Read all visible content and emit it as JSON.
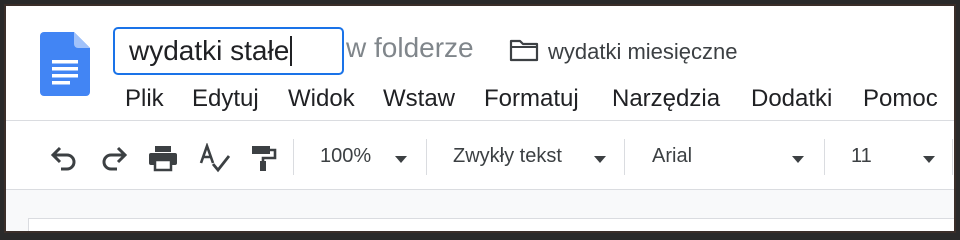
{
  "document": {
    "title": "wydatki stałe",
    "folder_hint": "w folderze",
    "folder_icon": "folder-icon",
    "folder_name": "wydatki miesięczne",
    "app_icon": "google-docs-icon",
    "accent_color": "#1a73e8",
    "docs_icon_color": "#4285f4"
  },
  "menu": {
    "items": [
      "Plik",
      "Edytuj",
      "Widok",
      "Wstaw",
      "Formatuj",
      "Narzędzia",
      "Dodatki",
      "Pomoc"
    ]
  },
  "toolbar": {
    "icons": [
      "undo-icon",
      "redo-icon",
      "print-icon",
      "spellcheck-icon",
      "paint-format-icon"
    ],
    "zoom": "100%",
    "style": "Zwykły tekst",
    "font": "Arial",
    "font_size": "11"
  }
}
